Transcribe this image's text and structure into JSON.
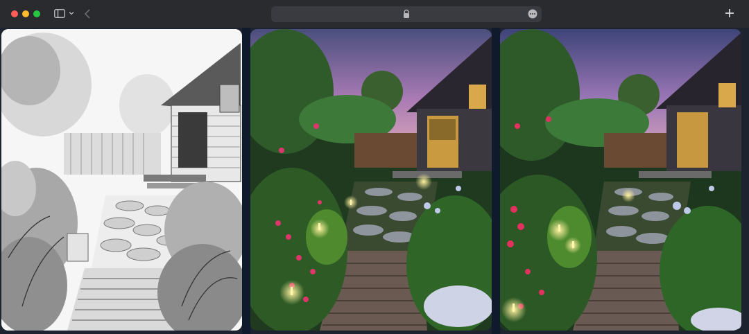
{
  "browser": {
    "address_text": "",
    "icons": {
      "sidebar": "sidebar-icon",
      "chevron": "chevron-down-icon",
      "back": "back-arrow-icon",
      "lock": "lock-icon",
      "more": "more-icon",
      "new_tab": "plus-icon"
    },
    "colors": {
      "close": "#ff5f57",
      "minimize": "#febc2e",
      "zoom": "#28c840"
    }
  },
  "images": [
    {
      "kind": "sketch",
      "subject": "garden-path-house"
    },
    {
      "kind": "photo",
      "subject": "garden-path-house-dusk"
    },
    {
      "kind": "photo",
      "subject": "garden-path-house-dusk"
    }
  ]
}
